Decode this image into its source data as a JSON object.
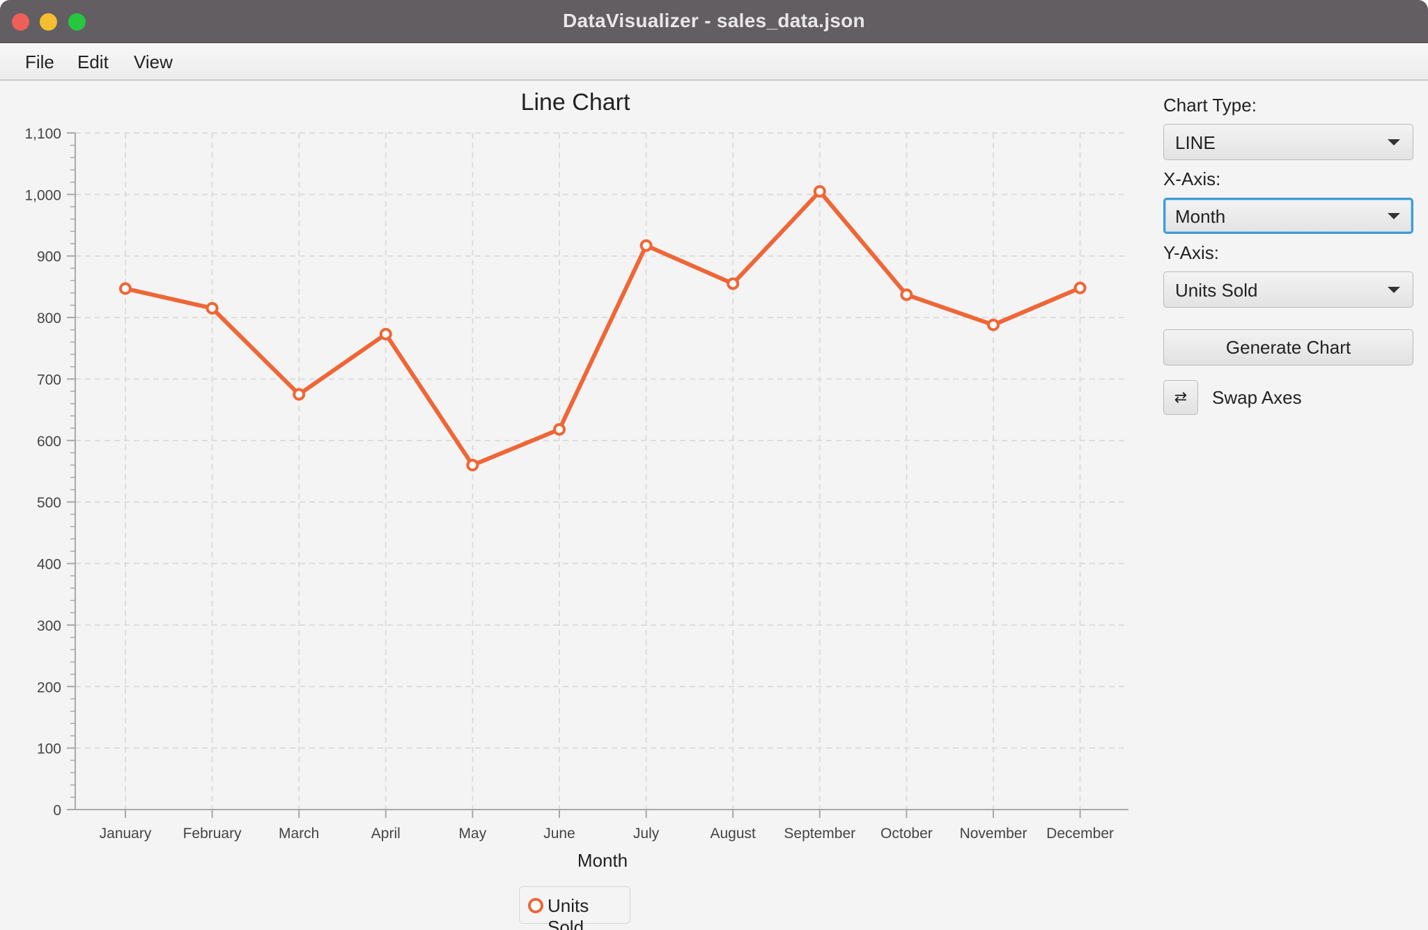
{
  "window": {
    "title": "DataVisualizer - sales_data.json"
  },
  "menu": [
    "File",
    "Edit",
    "View"
  ],
  "controls": {
    "chart_type_label": "Chart Type:",
    "chart_type_value": "LINE",
    "x_axis_label": "X-Axis:",
    "x_axis_value": "Month",
    "y_axis_label": "Y-Axis:",
    "y_axis_value": "Units Sold",
    "generate_label": "Generate Chart",
    "swap_icon": "⇄",
    "swap_label": "Swap Axes"
  },
  "colors": {
    "series": "#ef6637",
    "focus": "#3d9bd6",
    "titlebar": "#635e62"
  },
  "chart_data": {
    "type": "line",
    "title": "Line Chart",
    "xlabel": "Month",
    "ylabel": "",
    "categories": [
      "January",
      "February",
      "March",
      "April",
      "May",
      "June",
      "July",
      "August",
      "September",
      "October",
      "November",
      "December"
    ],
    "series": [
      {
        "name": "Units Sold",
        "values": [
          847,
          815,
          675,
          773,
          560,
          618,
          917,
          855,
          1005,
          837,
          788,
          848
        ]
      }
    ],
    "ylim": [
      0,
      1100
    ],
    "yticks": [
      0,
      100,
      200,
      300,
      400,
      500,
      600,
      700,
      800,
      900,
      1000,
      1100
    ],
    "ytick_labels": [
      "0",
      "100",
      "200",
      "300",
      "400",
      "500",
      "600",
      "700",
      "800",
      "900",
      "1,000",
      "1,100"
    ],
    "grid": true,
    "legend": "bottom"
  }
}
